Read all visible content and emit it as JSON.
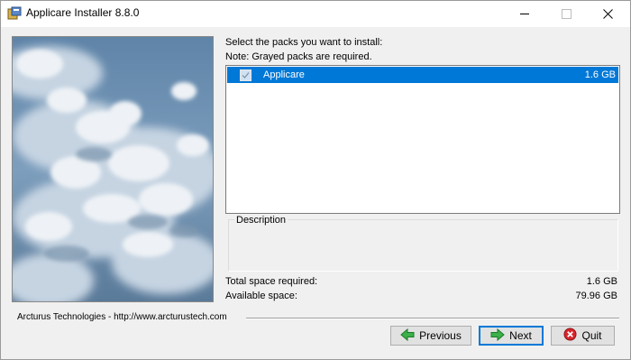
{
  "window": {
    "title": "Applicare Installer 8.8.0",
    "icon": "installer-icon"
  },
  "titlebar_buttons": [
    "minimize-icon",
    "maximize-icon",
    "close-icon"
  ],
  "main": {
    "heading": "Select the packs you want to install:",
    "note": "Note: Grayed packs are required.",
    "packs": [
      {
        "name": "Applicare",
        "size": "1.6 GB",
        "checked": true,
        "required": true,
        "selected": true
      }
    ],
    "description": {
      "label": "Description",
      "text": ""
    },
    "total_space": {
      "label": "Total space required:",
      "value": "1.6 GB"
    },
    "available_space": {
      "label": "Available space:",
      "value": "79.96 GB"
    }
  },
  "footer": {
    "vendor": "Arcturus Technologies - http://www.arcturustech.com",
    "buttons": {
      "previous": {
        "label": "Previous",
        "icon": "arrow-left-icon"
      },
      "next": {
        "label": "Next",
        "icon": "arrow-right-icon"
      },
      "quit": {
        "label": "Quit",
        "icon": "close-circle-icon"
      }
    }
  },
  "colors": {
    "selection": "#0078d7",
    "arrow_green": "#2fa43a",
    "quit_red": "#d9262c"
  }
}
